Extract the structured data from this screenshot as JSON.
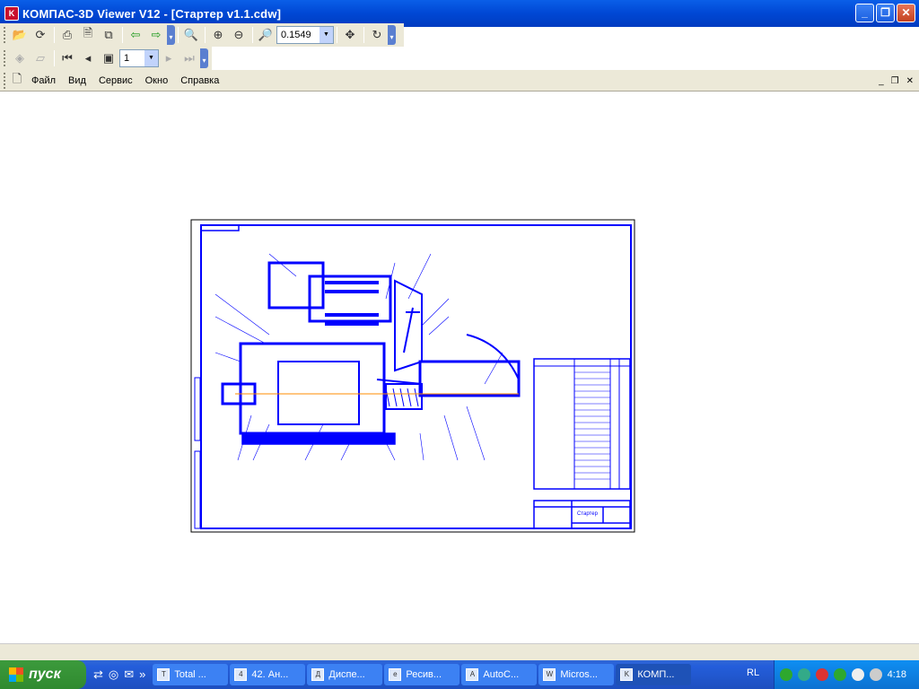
{
  "window": {
    "title": "КОМПАС-3D Viewer V12 - [Стартер v1.1.cdw]",
    "app_icon": "kompas-icon"
  },
  "toolbar1": {
    "zoom_value": "0.1549"
  },
  "toolbar2": {
    "page_value": "1"
  },
  "menu": [
    "Файл",
    "Вид",
    "Сервис",
    "Окно",
    "Справка"
  ],
  "drawing": {
    "title_block": "Стартер"
  },
  "taskbar": {
    "start_label": "пуск",
    "tasks": [
      "Total ...",
      "42. Ан...",
      "Диспе...",
      "Ресив...",
      "AutoC...",
      "Micros...",
      "КОМП..."
    ],
    "lang": "RL",
    "clock": "4:18"
  }
}
